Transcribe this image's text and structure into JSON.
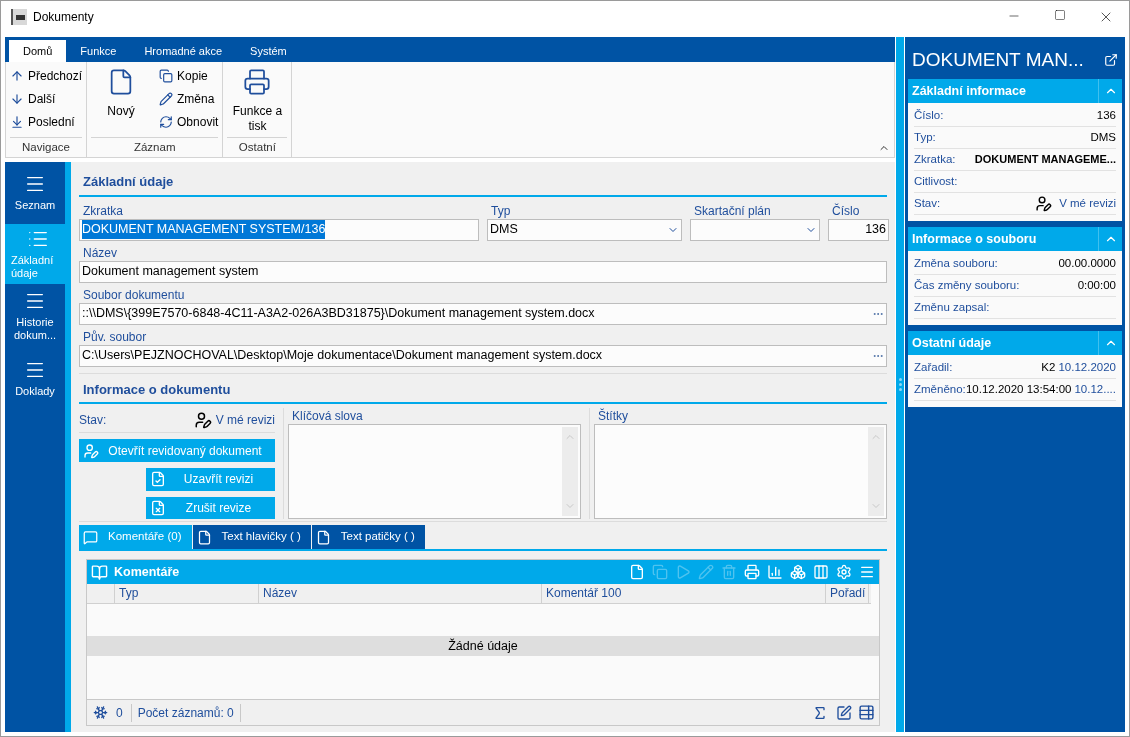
{
  "window": {
    "title": "Dokumenty"
  },
  "ribbon": {
    "tabs": [
      {
        "label": "Domů",
        "selected": true
      },
      {
        "label": "Funkce",
        "selected": false
      },
      {
        "label": "Hromadné akce",
        "selected": false
      },
      {
        "label": "Systém",
        "selected": false
      }
    ],
    "groups": [
      {
        "label": "Navigace",
        "small_buttons": [
          {
            "kind": "prev",
            "label": "Předchozí"
          },
          {
            "kind": "next",
            "label": "Další"
          },
          {
            "kind": "last",
            "label": "Poslední"
          }
        ]
      },
      {
        "label": "Záznam",
        "large_buttons": [
          {
            "kind": "new",
            "label": "Nový"
          }
        ],
        "small_buttons": [
          {
            "kind": "copy",
            "label": "Kopie"
          },
          {
            "kind": "edit",
            "label": "Změna"
          },
          {
            "kind": "refresh",
            "label": "Obnovit"
          }
        ]
      },
      {
        "label": "Ostatní",
        "large_buttons": [
          {
            "kind": "print",
            "label": "Funkce a tisk"
          }
        ]
      }
    ]
  },
  "nav": [
    {
      "label": "Seznam",
      "selected": false
    },
    {
      "label": "Základní údaje",
      "selected": true
    },
    {
      "label": "Historie dokum...",
      "selected": false
    },
    {
      "label": "Doklady",
      "selected": false
    }
  ],
  "basic": {
    "title": "Základní údaje",
    "zkratka": {
      "label": "Zkratka",
      "value": "DOKUMENT MANAGEMENT SYSTEM/136",
      "text_selected": true
    },
    "typ": {
      "label": "Typ",
      "value": "DMS"
    },
    "skartacni_plan": {
      "label": "Skartační plán"
    },
    "cislo": {
      "label": "Číslo",
      "value": "136"
    },
    "nazev": {
      "label": "Název",
      "value": "Dokument management system"
    },
    "soubor": {
      "label": "Soubor dokumentu",
      "value": "::\\\\DMS\\{399E7570-6848-4C11-A3A2-026A3BD31875}\\Dokument management system.docx"
    },
    "puv_soubor": {
      "label": "Pův. soubor",
      "value": "C:\\Users\\PEJZNOCHOVAL\\Desktop\\Moje dokumentace\\Dokument management system.docx"
    }
  },
  "info": {
    "title": "Informace o dokumentu",
    "status_label": "Stav:",
    "status_value": "V mé revizi",
    "buttons": [
      {
        "kind": "open",
        "label": "Otevřít revidovaný dokument"
      },
      {
        "kind": "close",
        "label": "Uzavřít revizi"
      },
      {
        "kind": "cancel",
        "label": "Zrušit revize"
      }
    ],
    "keywords_label": "Klíčová slova",
    "tags_label": "Štítky"
  },
  "bottom_tabs": [
    {
      "kind": "comments",
      "label": "Komentáře (0)",
      "selected": true
    },
    {
      "kind": "doc",
      "label": "Text hlavičky ( )",
      "selected": false
    },
    {
      "kind": "doc",
      "label": "Text patičky ( )",
      "selected": false
    }
  ],
  "grid": {
    "title": "Komentáře",
    "toolbar": [
      {
        "kind": "new",
        "disabled": false
      },
      {
        "kind": "copy",
        "disabled": true
      },
      {
        "kind": "play",
        "disabled": true
      },
      {
        "kind": "edit",
        "disabled": true
      },
      {
        "kind": "delete",
        "disabled": true
      },
      {
        "kind": "print",
        "disabled": false
      },
      {
        "kind": "chart",
        "disabled": false
      },
      {
        "kind": "cubes",
        "disabled": false
      },
      {
        "kind": "columns",
        "disabled": false
      },
      {
        "kind": "settings",
        "disabled": false
      },
      {
        "kind": "menu",
        "disabled": false
      }
    ],
    "columns": [
      "Typ",
      "Název",
      "Komentář 100",
      "Pořadí"
    ],
    "empty": "Žádné údaje",
    "footer": {
      "count": "0",
      "records": "Počet záznamů: 0"
    }
  },
  "side": {
    "title": "DOKUMENT MAN...",
    "sections": [
      {
        "title": "Základní informace",
        "expanded": true,
        "rows": [
          {
            "kind": "text",
            "label": "Číslo:",
            "value": "136"
          },
          {
            "kind": "text",
            "label": "Typ:",
            "value": "DMS"
          },
          {
            "kind": "bold",
            "label": "Zkratka:",
            "value": "DOKUMENT MANAGEME..."
          },
          {
            "kind": "text",
            "label": "Citlivost:"
          },
          {
            "kind": "status",
            "label": "Stav:",
            "link": "V mé revizi"
          }
        ]
      },
      {
        "title": "Informace o souboru",
        "expanded": true,
        "rows": [
          {
            "kind": "text",
            "label": "Změna souboru:",
            "value": "00.00.0000"
          },
          {
            "kind": "text",
            "label": "Čas změny souboru:",
            "value": "0:00:00"
          },
          {
            "kind": "text",
            "label": "Změnu zapsal:"
          }
        ]
      },
      {
        "title": "Ostatní údaje",
        "expanded": true,
        "rows": [
          {
            "kind": "text",
            "label": "Zařadil:",
            "value": "K2",
            "link": "10.12.2020"
          },
          {
            "kind": "text",
            "label": "Změněno:",
            "value": "10.12.2020 13:54:00",
            "link": "10.12...."
          }
        ]
      }
    ]
  }
}
